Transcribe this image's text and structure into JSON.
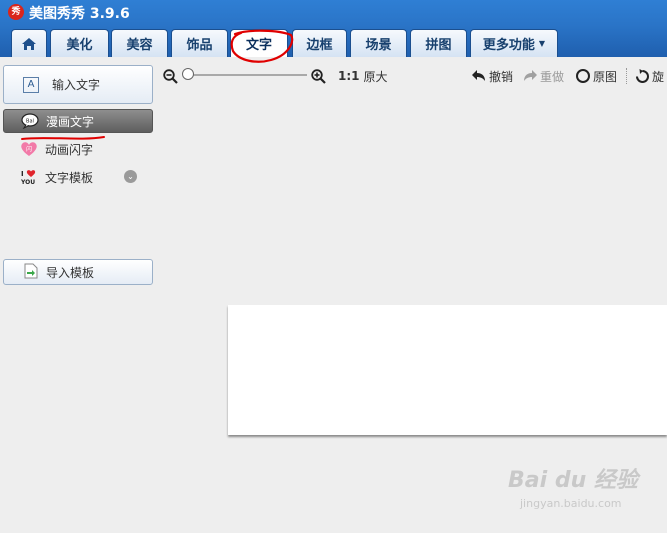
{
  "app": {
    "title": "美图秀秀 3.9.6",
    "logo_text": "秀"
  },
  "tabs": [
    {
      "label": "美化"
    },
    {
      "label": "美容"
    },
    {
      "label": "饰品"
    },
    {
      "label": "文字",
      "active": true
    },
    {
      "label": "边框"
    },
    {
      "label": "场景"
    },
    {
      "label": "拼图"
    },
    {
      "label": "更多功能"
    }
  ],
  "home_icon": "home-icon",
  "sidebar": {
    "input_text_button": "输入文字",
    "items": [
      {
        "label": "漫画文字",
        "icon": "speech-bubble-icon",
        "selected": true
      },
      {
        "label": "动画闪字",
        "icon": "flash-text-icon"
      },
      {
        "label": "文字模板",
        "icon": "love-you-icon",
        "expand_icon": "double-chevron-down-icon"
      }
    ],
    "import_template_button": "导入模板"
  },
  "toolbar": {
    "zoom_out_icon": "zoom-out-icon",
    "zoom_in_icon": "zoom-in-icon",
    "zoom_level": 0,
    "actual_size_prefix": "1:1",
    "actual_size_label": "原大",
    "undo_label": "撤销",
    "redo_label": "重做",
    "original_label": "原图",
    "rotate_label": "旋"
  },
  "watermark": {
    "text": "Bai du 经验",
    "sub": "jingyan.baidu.com"
  },
  "colors": {
    "tab_bar": "#2a74c7",
    "annotation": "#e00000",
    "selected_item": "#6e6e6e"
  }
}
